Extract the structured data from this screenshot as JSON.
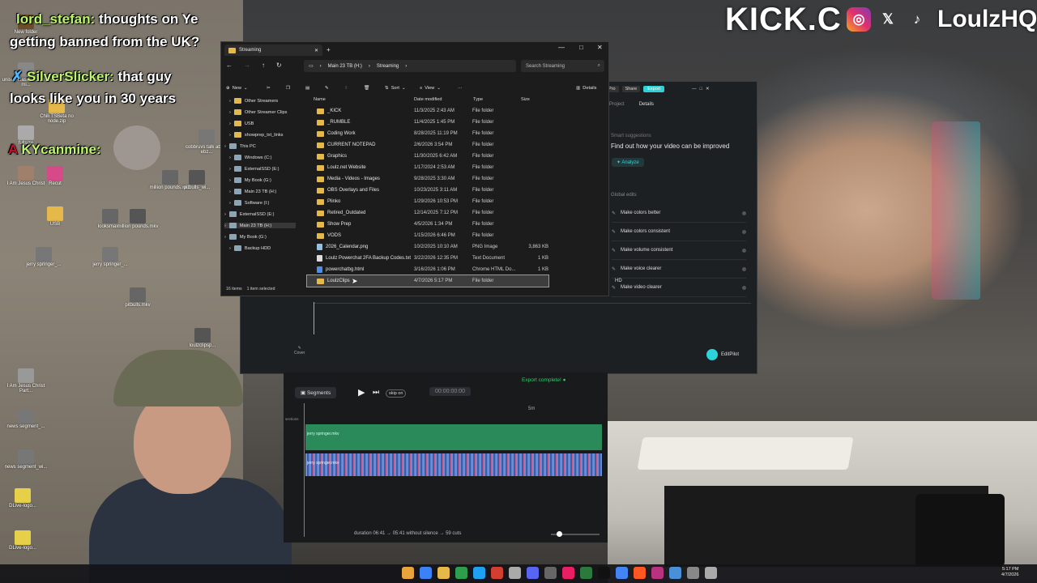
{
  "overlay": {
    "kick_banner": "KICK.C",
    "handle": "LoulzHQ",
    "social_icons": [
      "instagram-icon",
      "x-icon",
      "tiktok-icon"
    ],
    "chat": [
      {
        "user": "lord_stefan:",
        "text": "thoughts on Ye",
        "line2": "getting banned from the UK?"
      },
      {
        "user": "SilverSlicker:",
        "text": "that guy",
        "line2": "looks like you in 30 years"
      },
      {
        "user": "KYcanmine:",
        "text": ""
      }
    ]
  },
  "desktop_icons": [
    {
      "label": "New folder"
    },
    {
      "label": "unisex-class...mentra-mi..."
    },
    {
      "label": "Chili TSBeta no node.zip"
    },
    {
      "label": "fullsize"
    },
    {
      "label": "cobbruvs talk about ebz..."
    },
    {
      "label": "I Am Jesus Christ"
    },
    {
      "label": "Recut"
    },
    {
      "label": "million pounds.wi..."
    },
    {
      "label": "pitbulls_wi..."
    },
    {
      "label": "USB"
    },
    {
      "label": "looksmax..."
    },
    {
      "label": "million pounds.mkv"
    },
    {
      "label": "jerry springer_..."
    },
    {
      "label": "jerry springer_..."
    },
    {
      "label": "pitbulls.mkv"
    },
    {
      "label": "loulzclipsp..."
    },
    {
      "label": "I Am Jesus Christ Part..."
    },
    {
      "label": "news segment_..."
    },
    {
      "label": "news segment_wi..."
    },
    {
      "label": "DLive-logo..."
    },
    {
      "label": "DLive-logo..."
    }
  ],
  "explorer": {
    "tab_title": "Streaming",
    "breadcrumb": [
      "Main 23 TB (H:)",
      "Streaming"
    ],
    "search_placeholder": "Search Streaming",
    "toolbar": {
      "new": "New",
      "sort": "Sort",
      "view": "View",
      "details": "Details"
    },
    "columns": {
      "name": "Name",
      "date": "Date modified",
      "type": "Type",
      "size": "Size"
    },
    "nav_items": [
      {
        "label": "Other Streamers",
        "indent": 1
      },
      {
        "label": "Other Streamer Clips",
        "indent": 1
      },
      {
        "label": "USB",
        "indent": 1
      },
      {
        "label": "showprep_txt_links",
        "indent": 1
      },
      {
        "label": "This PC",
        "indent": 0
      },
      {
        "label": "Windows (C:)",
        "indent": 1
      },
      {
        "label": "ExternalSSD (E:)",
        "indent": 1
      },
      {
        "label": "My Book (G:)",
        "indent": 1
      },
      {
        "label": "Main 23 TB (H:)",
        "indent": 1
      },
      {
        "label": "Software (I:)",
        "indent": 1
      },
      {
        "label": "ExternalSSD (E:)",
        "indent": 0
      },
      {
        "label": "Main 23 TB (H:)",
        "indent": 0
      },
      {
        "label": "My Book (G:)",
        "indent": 0
      },
      {
        "label": "Backup HDD",
        "indent": 1
      }
    ],
    "files": [
      {
        "name": "_KICK",
        "date": "11/3/2025 2:43 AM",
        "type": "File folder",
        "size": "",
        "kind": "folder"
      },
      {
        "name": "_RUMBLE",
        "date": "11/4/2025 1:45 PM",
        "type": "File folder",
        "size": "",
        "kind": "folder"
      },
      {
        "name": "Coding Work",
        "date": "8/28/2025 11:19 PM",
        "type": "File folder",
        "size": "",
        "kind": "folder"
      },
      {
        "name": "CURRENT NOTEPAD",
        "date": "2/6/2026 3:54 PM",
        "type": "File folder",
        "size": "",
        "kind": "folder"
      },
      {
        "name": "Graphics",
        "date": "11/30/2025 6:42 AM",
        "type": "File folder",
        "size": "",
        "kind": "folder"
      },
      {
        "name": "Loulz.net Website",
        "date": "1/17/2024 2:53 AM",
        "type": "File folder",
        "size": "",
        "kind": "folder"
      },
      {
        "name": "Media - Videos - Images",
        "date": "9/28/2025 3:30 AM",
        "type": "File folder",
        "size": "",
        "kind": "folder"
      },
      {
        "name": "OBS Overlays and Files",
        "date": "10/23/2025 3:11 AM",
        "type": "File folder",
        "size": "",
        "kind": "folder"
      },
      {
        "name": "Plinko",
        "date": "1/29/2026 10:53 PM",
        "type": "File folder",
        "size": "",
        "kind": "folder"
      },
      {
        "name": "Retired_Outdated",
        "date": "12/14/2025 7:12 PM",
        "type": "File folder",
        "size": "",
        "kind": "folder"
      },
      {
        "name": "Show Prep",
        "date": "4/5/2026 1:34 PM",
        "type": "File folder",
        "size": "",
        "kind": "folder"
      },
      {
        "name": "VODS",
        "date": "1/15/2026 6:46 PM",
        "type": "File folder",
        "size": "",
        "kind": "folder"
      },
      {
        "name": "2026_Calendar.png",
        "date": "10/2/2025 10:10 AM",
        "type": "PNG Image",
        "size": "3,863 KB",
        "kind": "image"
      },
      {
        "name": "Loulz Powerchat 2FA Backup Codes.txt",
        "date": "3/22/2026 12:35 PM",
        "type": "Text Document",
        "size": "1 KB",
        "kind": "doc"
      },
      {
        "name": "powerchatbg.html",
        "date": "3/16/2026 1:06 PM",
        "type": "Chrome HTML Do...",
        "size": "1 KB",
        "kind": "html"
      },
      {
        "name": "LoulzClips",
        "date": "4/7/2026 5:17 PM",
        "type": "File folder",
        "size": "",
        "kind": "folder",
        "selected": true
      }
    ],
    "status": {
      "count": "16 items",
      "selected": "1 item selected"
    }
  },
  "editor": {
    "header_buttons": {
      "pro": "Pro",
      "share": "Share",
      "export": "Export"
    },
    "tabs": [
      "Project",
      "Details"
    ],
    "smart_title": "Smart suggestions",
    "smart_desc": "Find out how your video can be improved",
    "analyze": "Analyze",
    "global_title": "Global edits",
    "global_edits": [
      "Make colors better",
      "Make colors consistent",
      "Make volume consistent",
      "Make voice clearer",
      "Make video clearer"
    ],
    "hd_badge": "HD",
    "cover_label": "Cover",
    "editpilot": "EditPilot",
    "export_complete": "Export complete!",
    "segments_label": "Segments",
    "skip_label": "skip on",
    "timecode": "00:00:00:00",
    "ruler_mark": "5m",
    "sections_label": "sections",
    "clip1": "jerry springer.mkv",
    "clip2": "jerry springer.mkv",
    "duration_text": "duration 06:41 → 05:41 without silence → 59 cuts"
  },
  "taskbar": {
    "time": "5:17 PM",
    "date": "4/7/2026"
  },
  "colors": {
    "accent_cyan": "#2cd3d8",
    "folder": "#e6b84a",
    "green_clip": "#2a8a5a",
    "chat_user": "#bdf56b"
  }
}
